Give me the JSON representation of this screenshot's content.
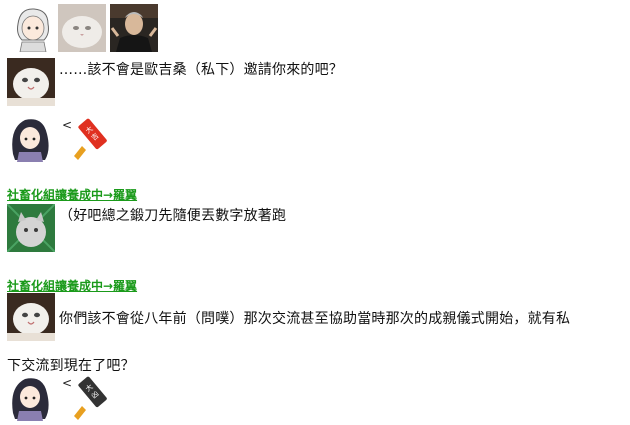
{
  "thread": {
    "msg1": {
      "text": "……該不會是歐吉桑（私下）邀請你來的吧？"
    },
    "reply1": {
      "prefix": "<",
      "stamp": "大吉"
    },
    "section1": {
      "link": "社畜化組讓養成中→羅翼"
    },
    "msg2": {
      "text": "（好吧總之鍛刀先隨便丟數字放著跑"
    },
    "section2": {
      "link": "社畜化組讓養成中→羅翼"
    },
    "msg3": {
      "text": "你們該不會從八年前（問噗）那次交流甚至協助當時那次的成親儀式開始，就有私下交流到現在了吧？"
    },
    "reply2": {
      "prefix": "<",
      "stamp": "大凶"
    }
  },
  "colors": {
    "link": "#1a9a1a",
    "stamp_good": "#e03020",
    "stamp_bad": "#333333",
    "stick": "#e8a020"
  }
}
